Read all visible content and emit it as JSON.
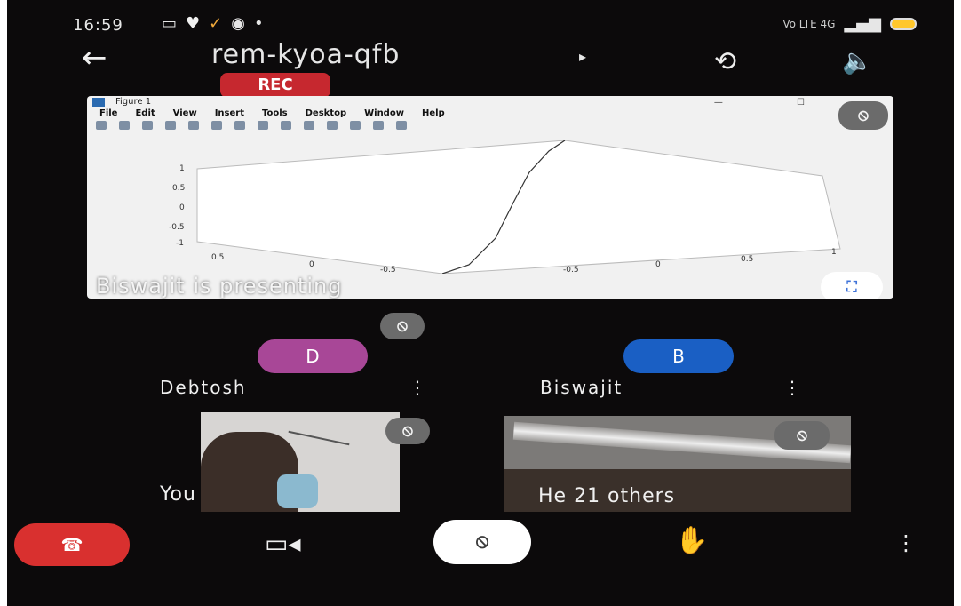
{
  "status_bar": {
    "time": "16:59",
    "icons": [
      "▭",
      "♥",
      "✓",
      "◉",
      "•"
    ],
    "network": "Vo LTE 4G",
    "signal": "▂▄▆",
    "battery_color": "#ffc72c"
  },
  "header": {
    "back_icon": "←",
    "meeting_code": "rem-kyoa-qfb",
    "chevron": "▸",
    "rec_label": "REC",
    "rotate_icon": "⟲",
    "speaker_icon": "🔈"
  },
  "presentation": {
    "window_title": "Figure 1",
    "menu_items": [
      "File",
      "Edit",
      "View",
      "Insert",
      "Tools",
      "Desktop",
      "Window",
      "Help"
    ],
    "window_controls": "— ☐",
    "mute_icon": "⦸",
    "presenting_text": "Biswajit is presenting",
    "fullscreen_icon": "⛶",
    "chart": {
      "y_ticks": [
        "1",
        "0.5",
        "0",
        "-0.5",
        "-1"
      ],
      "x_ticks_left": [
        "0.5",
        "0",
        "-0.5"
      ],
      "x_ticks_right": [
        "-0.5",
        "0",
        "0.5",
        "1"
      ]
    }
  },
  "participants": [
    {
      "initial": "D",
      "name": "Debtosh",
      "avatar_color": "#a84797"
    },
    {
      "initial": "B",
      "name": "Biswajit",
      "avatar_color": "#1a5fc4"
    }
  ],
  "videos": [
    {
      "label": "You"
    },
    {
      "label": "He 21 others"
    }
  ],
  "controls": {
    "end_icon": "☎",
    "camera_icon": "▭◂",
    "mic_icon": "⦸",
    "hand_icon": "✋",
    "more_icon": "⋮"
  },
  "more_icon": "⋮",
  "mute_icon": "⦸"
}
